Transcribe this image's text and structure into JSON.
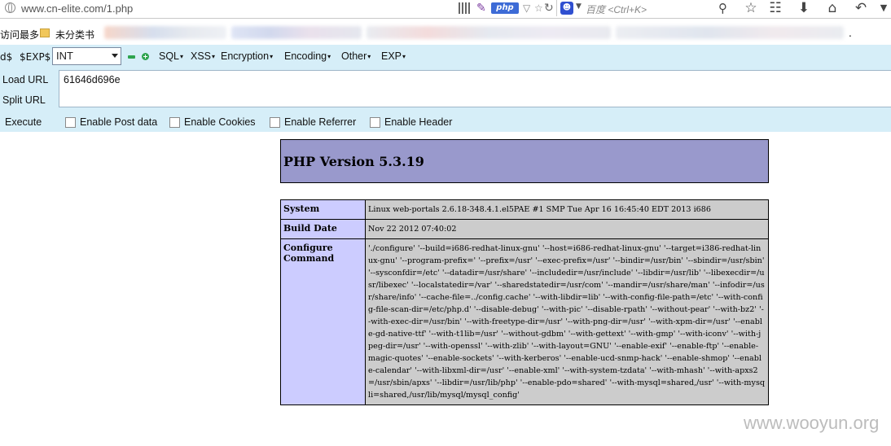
{
  "browser": {
    "url": "www.cn-elite.com/1.php",
    "php_badge": "php",
    "search_placeholder": "百度 <Ctrl+K>"
  },
  "bookmarks": {
    "most_visited": "访问最多",
    "uncategorized": "未分类书",
    "trailing": "."
  },
  "hackbar": {
    "toolbar_fragment": "d$",
    "exp_tag": "$EXP$",
    "type_select": "INT",
    "menus": [
      "SQL",
      "XSS",
      "Encryption",
      "Encoding",
      "Other",
      "EXP"
    ],
    "load_url": "Load URL",
    "split_url": "Split URL",
    "execute": "Execute",
    "url_value": "61646d696e",
    "checkboxes": [
      "Enable Post data",
      "Enable Cookies",
      "Enable Referrer",
      "Enable Header"
    ]
  },
  "phpinfo": {
    "title": "PHP Version 5.3.19",
    "rows": [
      {
        "key": "System",
        "value": "Linux web-portals 2.6.18-348.4.1.el5PAE #1 SMP Tue Apr 16 16:45:40 EDT 2013 i686"
      },
      {
        "key": "Build Date",
        "value": "Nov 22 2012 07:40:02"
      },
      {
        "key": "Configure Command",
        "value": "'./configure' '--build=i686-redhat-linux-gnu' '--host=i686-redhat-linux-gnu' '--target=i386-redhat-linux-gnu' '--program-prefix=' '--prefix=/usr' '--exec-prefix=/usr' '--bindir=/usr/bin' '--sbindir=/usr/sbin' '--sysconfdir=/etc' '--datadir=/usr/share' '--includedir=/usr/include' '--libdir=/usr/lib' '--libexecdir=/usr/libexec' '--localstatedir=/var' '--sharedstatedir=/usr/com' '--mandir=/usr/share/man' '--infodir=/usr/share/info' '--cache-file=../config.cache' '--with-libdir=lib' '--with-config-file-path=/etc' '--with-config-file-scan-dir=/etc/php.d' '--disable-debug' '--with-pic' '--disable-rpath' '--without-pear' '--with-bz2' '--with-exec-dir=/usr/bin' '--with-freetype-dir=/usr' '--with-png-dir=/usr' '--with-xpm-dir=/usr' '--enable-gd-native-ttf' '--with-t1lib=/usr' '--without-gdbm' '--with-gettext' '--with-gmp' '--with-iconv' '--with-jpeg-dir=/usr' '--with-openssl' '--with-zlib' '--with-layout=GNU' '--enable-exif' '--enable-ftp' '--enable-magic-quotes' '--enable-sockets' '--with-kerberos' '--enable-ucd-snmp-hack' '--enable-shmop' '--enable-calendar' '--with-libxml-dir=/usr' '--enable-xml' '--with-system-tzdata' '--with-mhash' '--with-apxs2=/usr/sbin/apxs' '--libdir=/usr/lib/php' '--enable-pdo=shared' '--with-mysql=shared,/usr' '--with-mysqli=shared,/usr/lib/mysql/mysql_config'"
      }
    ]
  },
  "watermark": "www.wooyun.org",
  "colors": {
    "hackbar_bg": "#d6eef8",
    "php_header_bg": "#9999cc",
    "key_cell_bg": "#ccccff",
    "value_cell_bg": "#cccccc"
  }
}
